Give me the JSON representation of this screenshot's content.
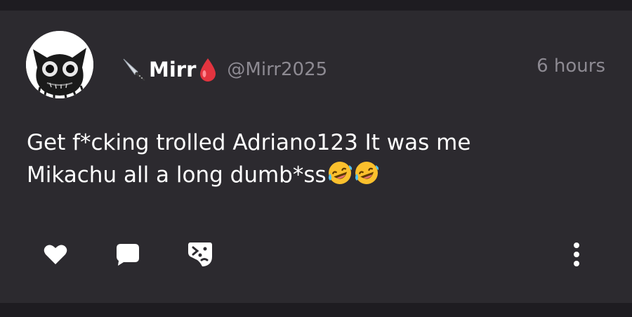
{
  "post": {
    "author": {
      "display_name": "Mirr",
      "handle": "@Mirr2025",
      "name_prefix_icon": "knife-icon",
      "name_suffix_icon": "blood-drop-icon",
      "avatar": "black-cat-avatar"
    },
    "time": "6 hours",
    "body_line1": "Get f*cking trolled Adriano123 It was me",
    "body_line2": "Mikachu all a long dumb*ss",
    "body_emojis": [
      "rolling-on-floor-laughing-emoji",
      "rolling-on-floor-laughing-emoji"
    ]
  },
  "actions": {
    "icons": [
      "heart-icon",
      "comment-icon",
      "share-icon",
      "more-vertical-icon"
    ]
  },
  "colors": {
    "page_background": "#1e1c21",
    "card_background": "#2c2a2f",
    "secondary_text": "#8d8a92",
    "primary_text": "#ffffff"
  }
}
